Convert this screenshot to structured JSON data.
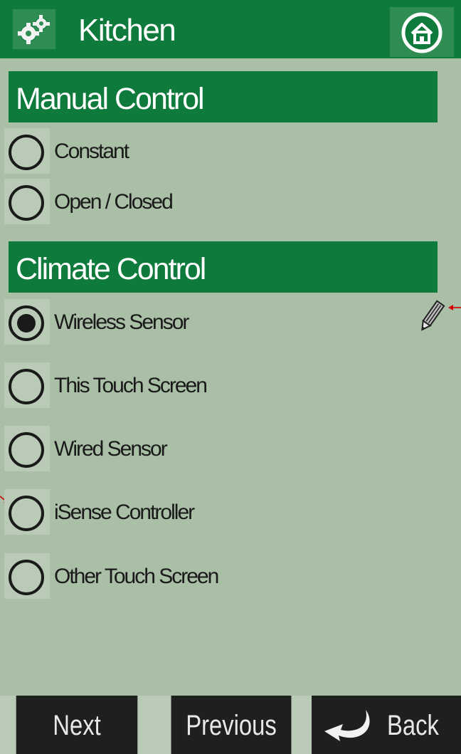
{
  "header": {
    "title": "Kitchen",
    "settings_icon": "gears-icon",
    "home_icon": "home-icon"
  },
  "sections": {
    "manual": {
      "title": "Manual Control",
      "options": [
        "Constant",
        "Open / Closed"
      ]
    },
    "climate": {
      "title": "Climate Control",
      "options": [
        "Wireless Sensor",
        "This Touch Screen",
        "Wired Sensor",
        "iSense Controller",
        "Other Touch Screen"
      ],
      "selected": "Wireless Sensor",
      "edit_icon": "pencil-icon"
    }
  },
  "footer": {
    "next": "Next",
    "previous": "Previous",
    "back": "Back",
    "back_icon": "return-arrow-icon"
  },
  "colors": {
    "header_green": "#0e7a3c",
    "background": "#a9bfa6",
    "footer_button": "#1f1f1f",
    "annotation_arrow": "#d40000"
  }
}
